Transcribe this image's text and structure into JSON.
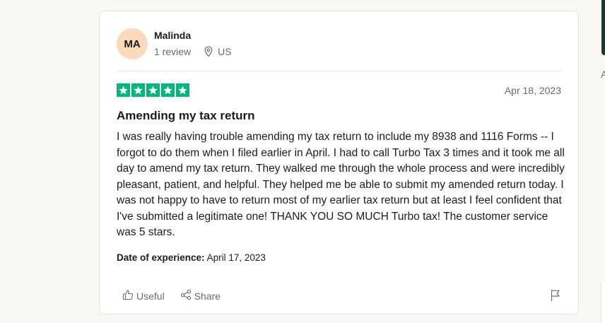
{
  "review": {
    "avatar_initials": "MA",
    "reviewer_name": "Malinda",
    "review_count": "1 review",
    "country": "US",
    "rating": 5,
    "date": "Apr 18, 2023",
    "title": "Amending my tax return",
    "body": "I was really having trouble amending my tax return to include my 8938 and 1116 Forms -- I forgot to do them when I filed earlier in April. I had to call Turbo Tax 3 times and it took me all day to amend my tax return. They walked me through the whole process and were incredibly pleasant, patient, and helpful. They helped me be able to submit my amended return today. I was not happy to have to return most of my earlier tax return but at least I feel confident that I've submitted a legitimate one! THANK YOU SO MUCH Turbo tax! The customer service was 5 stars.",
    "experience_label": "Date of experience:",
    "experience_date": "April 17, 2023"
  },
  "actions": {
    "useful_label": "Useful",
    "share_label": "Share"
  },
  "side": {
    "partial_letter": "A"
  },
  "colors": {
    "star_green": "#00b67a",
    "avatar_bg": "#fbd9bb",
    "page_bg": "#f9f8f4"
  }
}
